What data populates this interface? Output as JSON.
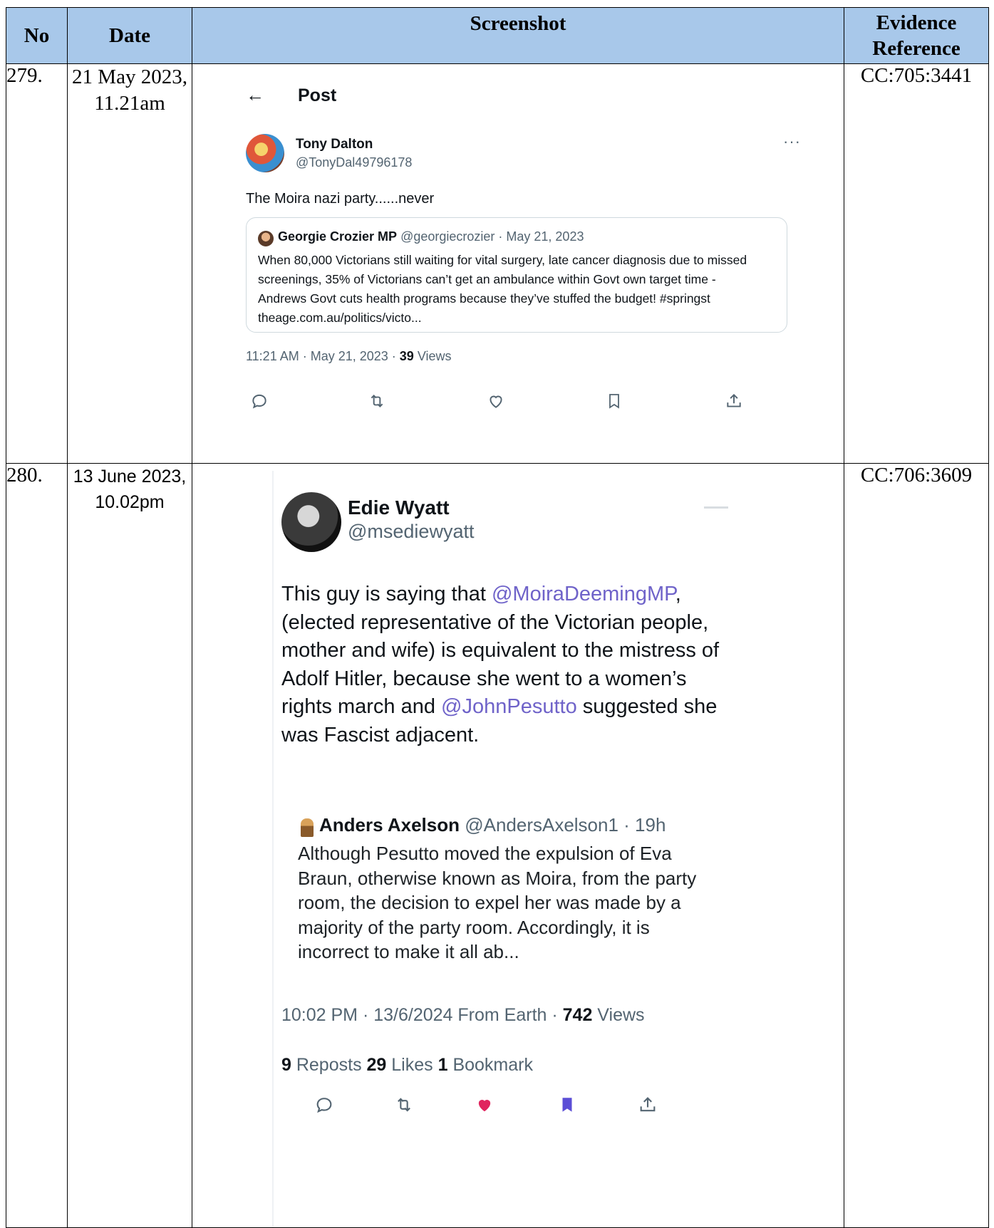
{
  "table": {
    "headers": {
      "no": "No",
      "date": "Date",
      "screenshot": "Screenshot",
      "evidence": "Evidence Reference"
    },
    "rows": [
      {
        "no": "279.",
        "date": "21 May 2023, 11.21am",
        "evidence": "CC:705:3441",
        "tweet": {
          "page_title": "Post",
          "back_icon": "←",
          "author_name": "Tony Dalton",
          "author_handle": "@TonyDal49796178",
          "more_icon": "···",
          "text": "The Moira nazi party......never",
          "quote": {
            "author_name": "Georgie Crozier MP",
            "author_meta": "@georgiecrozier · May 21, 2023",
            "text": "When 80,000 Victorians still waiting for vital surgery, late cancer diagnosis due to missed screenings, 35% of Victorians can’t get an ambulance within Govt own target time - Andrews Govt cuts health programs because they’ve stuffed the budget! #springst theage.com.au/politics/victo..."
          },
          "meta_prefix": "11:21 AM · May 21, 2023 · ",
          "views_count": "39",
          "views_label": " Views",
          "icons": [
            "reply-icon",
            "repost-icon",
            "like-icon",
            "bookmark-icon",
            "share-icon"
          ]
        }
      },
      {
        "no": "280.",
        "date": "13 June 2023, 10.02pm",
        "evidence": "CC:706:3609",
        "tweet": {
          "author_name": "Edie Wyatt",
          "author_handle": "@msediewyatt",
          "text_parts": {
            "a": "This guy is saying that ",
            "mention1": "@MoiraDeemingMP",
            "b": ", (elected representative of the Victorian people, mother and wife) is equivalent to the mistress of Adolf Hitler, because she went to a women’s rights march and ",
            "mention2": "@JohnPesutto",
            "c": " suggested she was Fascist adjacent."
          },
          "quote": {
            "author_name": "Anders Axelson",
            "author_meta": " @AndersAxelson1 · 19h",
            "text": "Although Pesutto moved the expulsion of Eva Braun, otherwise known as Moira, from the party room, the decision to expel her was made by a majority of the party room. Accordingly, it is incorrect to make it all ab..."
          },
          "meta_prefix": "10:02 PM · 13/6/2024 From Earth · ",
          "views_count": "742",
          "views_label": " Views",
          "reposts_count": "9",
          "reposts_label": " Reposts ",
          "likes_count": "29",
          "likes_label": " Likes ",
          "bookmarks_count": "1",
          "bookmarks_label": " Bookmark",
          "icons": [
            "reply-icon",
            "repost-icon",
            "liked-heart-icon",
            "bookmarked-icon",
            "share-icon"
          ],
          "colors": {
            "mention": "#6f63c9",
            "liked": "#e0245e",
            "bookmarked": "#5b4ed6"
          }
        }
      }
    ],
    "colors": {
      "header_bg": "#a8c8ea"
    }
  }
}
